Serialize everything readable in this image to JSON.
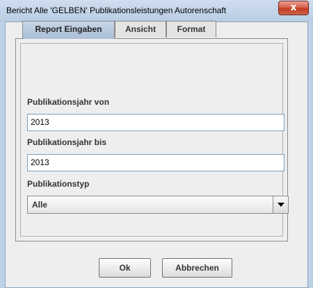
{
  "window": {
    "title": "Bericht Alle 'GELBEN' Publikationsleistungen Autorenschaft",
    "close_label": "x"
  },
  "tabs": [
    {
      "label": "Report Eingaben",
      "active": true
    },
    {
      "label": "Ansicht",
      "active": false
    },
    {
      "label": "Format",
      "active": false
    }
  ],
  "form": {
    "year_from_label": "Publikationsjahr von",
    "year_from_value": "2013",
    "year_to_label": "Publikationsjahr bis",
    "year_to_value": "2013",
    "type_label": "Publikationstyp",
    "type_value": "Alle"
  },
  "buttons": {
    "ok_label": "Ok",
    "cancel_label": "Abbrechen"
  },
  "icons": {
    "close": "close-icon",
    "dropdown": "chevron-down-icon"
  }
}
